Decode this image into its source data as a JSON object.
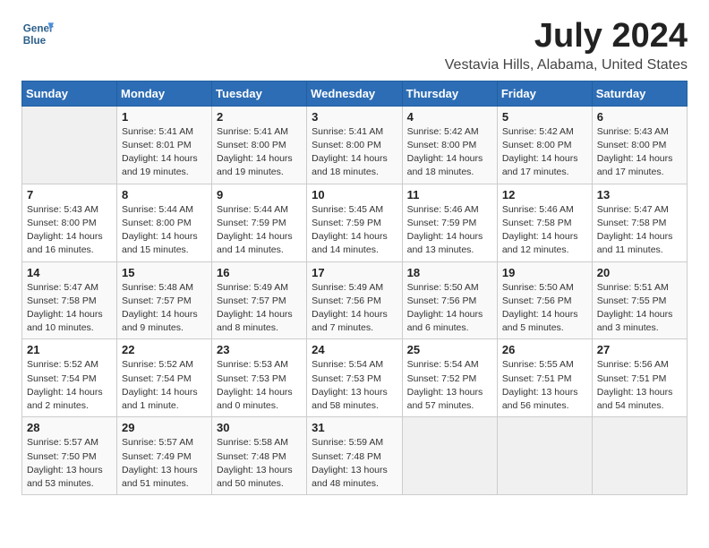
{
  "header": {
    "logo_line1": "General",
    "logo_line2": "Blue",
    "title": "July 2024",
    "subtitle": "Vestavia Hills, Alabama, United States"
  },
  "calendar": {
    "days_of_week": [
      "Sunday",
      "Monday",
      "Tuesday",
      "Wednesday",
      "Thursday",
      "Friday",
      "Saturday"
    ],
    "weeks": [
      [
        {
          "day": "",
          "info": ""
        },
        {
          "day": "1",
          "info": "Sunrise: 5:41 AM\nSunset: 8:01 PM\nDaylight: 14 hours\nand 19 minutes."
        },
        {
          "day": "2",
          "info": "Sunrise: 5:41 AM\nSunset: 8:00 PM\nDaylight: 14 hours\nand 19 minutes."
        },
        {
          "day": "3",
          "info": "Sunrise: 5:41 AM\nSunset: 8:00 PM\nDaylight: 14 hours\nand 18 minutes."
        },
        {
          "day": "4",
          "info": "Sunrise: 5:42 AM\nSunset: 8:00 PM\nDaylight: 14 hours\nand 18 minutes."
        },
        {
          "day": "5",
          "info": "Sunrise: 5:42 AM\nSunset: 8:00 PM\nDaylight: 14 hours\nand 17 minutes."
        },
        {
          "day": "6",
          "info": "Sunrise: 5:43 AM\nSunset: 8:00 PM\nDaylight: 14 hours\nand 17 minutes."
        }
      ],
      [
        {
          "day": "7",
          "info": "Sunrise: 5:43 AM\nSunset: 8:00 PM\nDaylight: 14 hours\nand 16 minutes."
        },
        {
          "day": "8",
          "info": "Sunrise: 5:44 AM\nSunset: 8:00 PM\nDaylight: 14 hours\nand 15 minutes."
        },
        {
          "day": "9",
          "info": "Sunrise: 5:44 AM\nSunset: 7:59 PM\nDaylight: 14 hours\nand 14 minutes."
        },
        {
          "day": "10",
          "info": "Sunrise: 5:45 AM\nSunset: 7:59 PM\nDaylight: 14 hours\nand 14 minutes."
        },
        {
          "day": "11",
          "info": "Sunrise: 5:46 AM\nSunset: 7:59 PM\nDaylight: 14 hours\nand 13 minutes."
        },
        {
          "day": "12",
          "info": "Sunrise: 5:46 AM\nSunset: 7:58 PM\nDaylight: 14 hours\nand 12 minutes."
        },
        {
          "day": "13",
          "info": "Sunrise: 5:47 AM\nSunset: 7:58 PM\nDaylight: 14 hours\nand 11 minutes."
        }
      ],
      [
        {
          "day": "14",
          "info": "Sunrise: 5:47 AM\nSunset: 7:58 PM\nDaylight: 14 hours\nand 10 minutes."
        },
        {
          "day": "15",
          "info": "Sunrise: 5:48 AM\nSunset: 7:57 PM\nDaylight: 14 hours\nand 9 minutes."
        },
        {
          "day": "16",
          "info": "Sunrise: 5:49 AM\nSunset: 7:57 PM\nDaylight: 14 hours\nand 8 minutes."
        },
        {
          "day": "17",
          "info": "Sunrise: 5:49 AM\nSunset: 7:56 PM\nDaylight: 14 hours\nand 7 minutes."
        },
        {
          "day": "18",
          "info": "Sunrise: 5:50 AM\nSunset: 7:56 PM\nDaylight: 14 hours\nand 6 minutes."
        },
        {
          "day": "19",
          "info": "Sunrise: 5:50 AM\nSunset: 7:56 PM\nDaylight: 14 hours\nand 5 minutes."
        },
        {
          "day": "20",
          "info": "Sunrise: 5:51 AM\nSunset: 7:55 PM\nDaylight: 14 hours\nand 3 minutes."
        }
      ],
      [
        {
          "day": "21",
          "info": "Sunrise: 5:52 AM\nSunset: 7:54 PM\nDaylight: 14 hours\nand 2 minutes."
        },
        {
          "day": "22",
          "info": "Sunrise: 5:52 AM\nSunset: 7:54 PM\nDaylight: 14 hours\nand 1 minute."
        },
        {
          "day": "23",
          "info": "Sunrise: 5:53 AM\nSunset: 7:53 PM\nDaylight: 14 hours\nand 0 minutes."
        },
        {
          "day": "24",
          "info": "Sunrise: 5:54 AM\nSunset: 7:53 PM\nDaylight: 13 hours\nand 58 minutes."
        },
        {
          "day": "25",
          "info": "Sunrise: 5:54 AM\nSunset: 7:52 PM\nDaylight: 13 hours\nand 57 minutes."
        },
        {
          "day": "26",
          "info": "Sunrise: 5:55 AM\nSunset: 7:51 PM\nDaylight: 13 hours\nand 56 minutes."
        },
        {
          "day": "27",
          "info": "Sunrise: 5:56 AM\nSunset: 7:51 PM\nDaylight: 13 hours\nand 54 minutes."
        }
      ],
      [
        {
          "day": "28",
          "info": "Sunrise: 5:57 AM\nSunset: 7:50 PM\nDaylight: 13 hours\nand 53 minutes."
        },
        {
          "day": "29",
          "info": "Sunrise: 5:57 AM\nSunset: 7:49 PM\nDaylight: 13 hours\nand 51 minutes."
        },
        {
          "day": "30",
          "info": "Sunrise: 5:58 AM\nSunset: 7:48 PM\nDaylight: 13 hours\nand 50 minutes."
        },
        {
          "day": "31",
          "info": "Sunrise: 5:59 AM\nSunset: 7:48 PM\nDaylight: 13 hours\nand 48 minutes."
        },
        {
          "day": "",
          "info": ""
        },
        {
          "day": "",
          "info": ""
        },
        {
          "day": "",
          "info": ""
        }
      ]
    ]
  }
}
